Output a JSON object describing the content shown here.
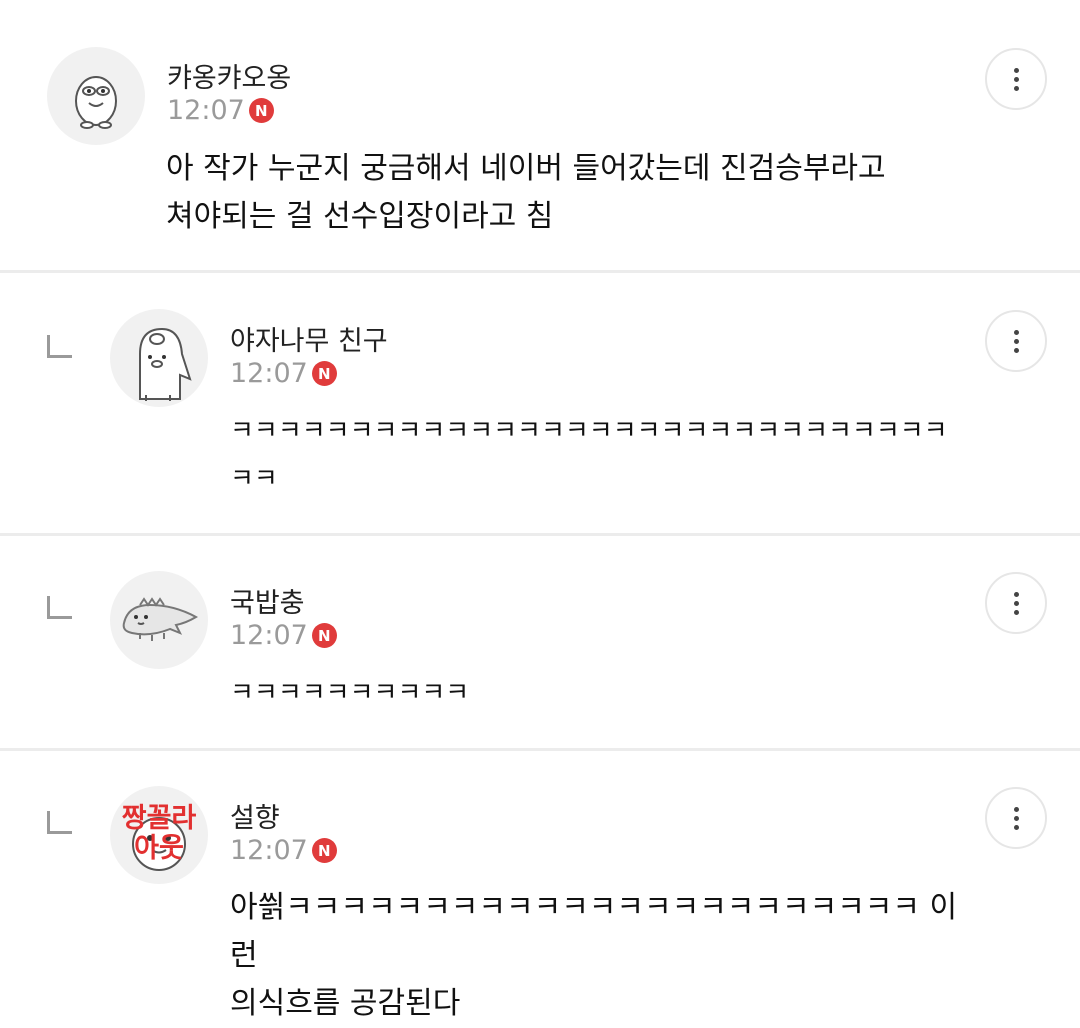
{
  "new_badge": "N",
  "colors": {
    "new_badge": "#e03b3b",
    "divider": "#ececec",
    "stamp": "#e23030"
  },
  "comments": [
    {
      "username": "캬옹캬오옹",
      "time": "12:07",
      "text": "아 작가 누군지 궁금해서 네이버 들어갔는데 진검승부라고\n쳐야되는 걸 선수입장이라고 침",
      "avatar_icon": "duck-character-icon",
      "is_reply": false
    },
    {
      "username": "야자나무 친구",
      "time": "12:07",
      "text": "ㅋㅋㅋㅋㅋㅋㅋㅋㅋㅋㅋㅋㅋㅋㅋㅋㅋㅋㅋㅋㅋㅋㅋㅋㅋㅋㅋㅋㅋㅋ\nㅋㅋ",
      "avatar_icon": "penguin-pig-character-icon",
      "is_reply": true
    },
    {
      "username": "국밥충",
      "time": "12:07",
      "text": "ㅋㅋㅋㅋㅋㅋㅋㅋㅋㅋ",
      "avatar_icon": "lizard-character-icon",
      "is_reply": true
    },
    {
      "username": "설향",
      "time": "12:07",
      "text": "아씕ㅋㅋㅋㅋㅋㅋㅋㅋㅋㅋㅋㅋㅋㅋㅋㅋㅋㅋㅋㅋㅋㅋㅋ 이런\n의식흐름 공감된다",
      "avatar_icon": "character-with-stamp-icon",
      "avatar_stamp": "짱꼴라\n아웃",
      "is_reply": true
    }
  ]
}
